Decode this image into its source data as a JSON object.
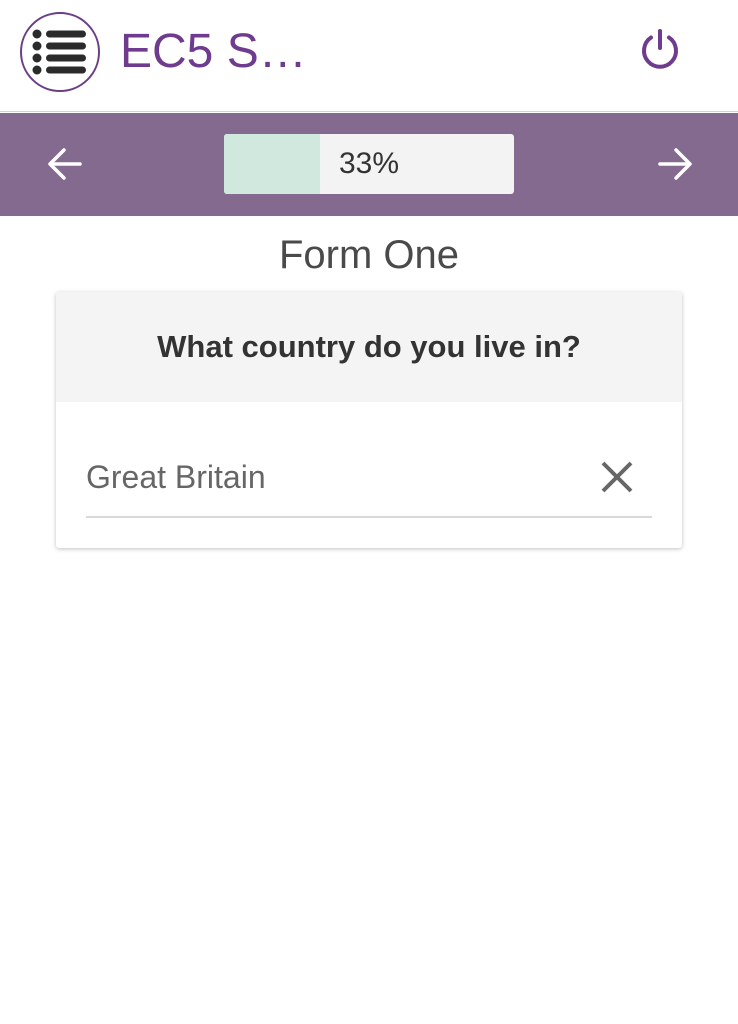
{
  "header": {
    "app_title": "EC5 S…",
    "menu_icon": "list-icon",
    "power_icon": "power-icon",
    "accent_color": "#6e3b8e"
  },
  "navbar": {
    "background_color": "#836a8e",
    "prev_icon": "arrow-left-icon",
    "next_icon": "arrow-right-icon",
    "progress_percent": 33,
    "progress_text": "33%"
  },
  "form": {
    "title": "Form One",
    "question": "What country do you live in?",
    "answer_value": "Great Britain",
    "clear_icon": "close-icon"
  }
}
